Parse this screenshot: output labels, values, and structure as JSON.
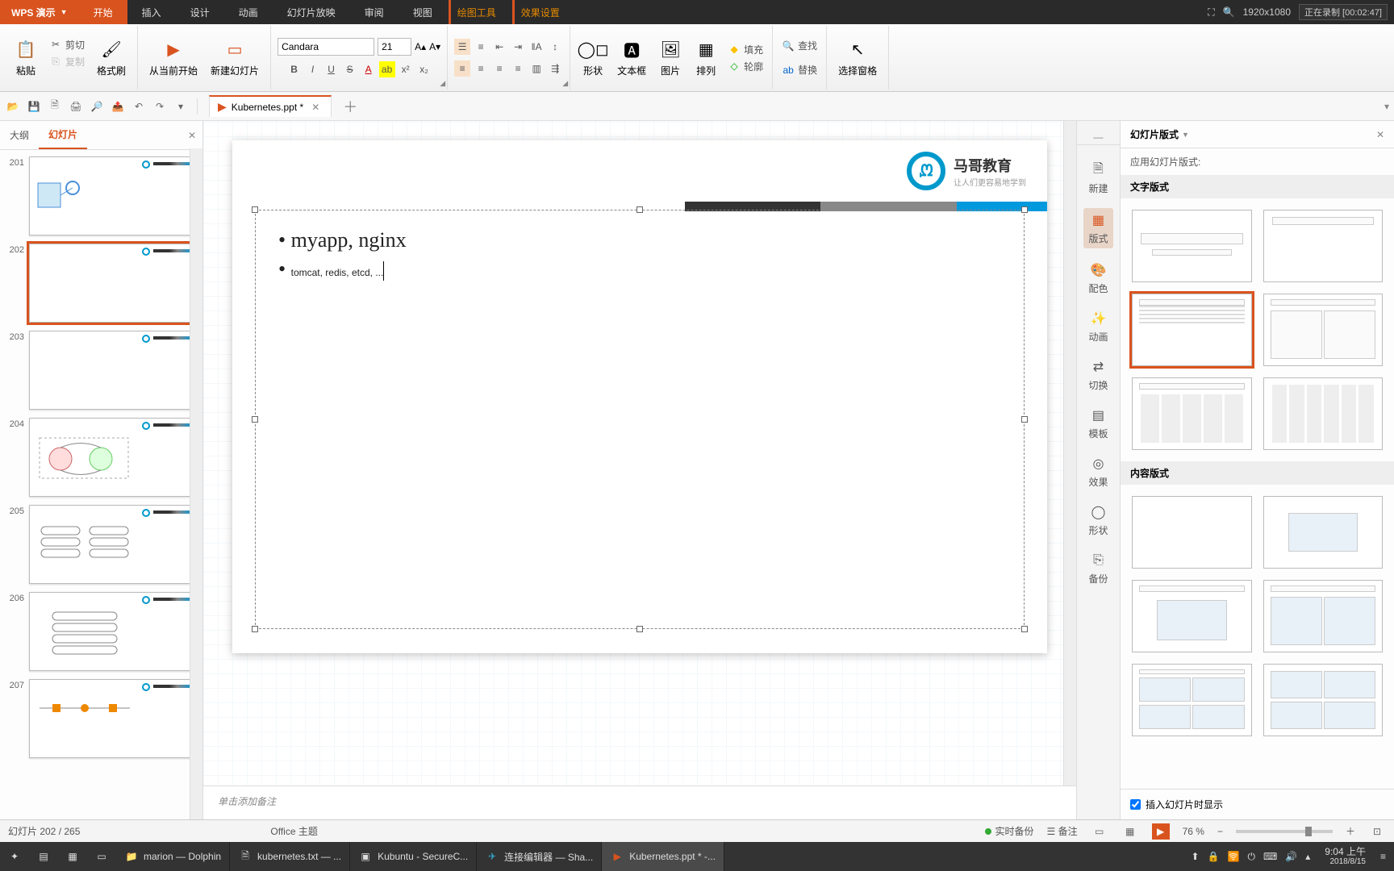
{
  "app": {
    "name": "WPS 演示"
  },
  "menu": {
    "items": [
      "开始",
      "插入",
      "设计",
      "动画",
      "幻灯片放映",
      "审阅",
      "视图"
    ],
    "tools": [
      "绘图工具",
      "效果设置"
    ],
    "active": "开始"
  },
  "titlebar_right": {
    "resolution": "1920x1080",
    "recording": "正在录制 [00:02:47]"
  },
  "ribbon": {
    "paste": "粘贴",
    "cut": "剪切",
    "copy": "复制",
    "format_painter": "格式刷",
    "from_current": "从当前开始",
    "new_slide": "新建幻灯片",
    "font_name": "Candara",
    "font_size": "21",
    "shape": "形状",
    "textbox": "文本框",
    "picture": "图片",
    "arrange": "排列",
    "outline_btn": "轮廓",
    "fill": "填充",
    "find": "查找",
    "replace": "替换",
    "select_pane": "选择窗格"
  },
  "qat": {
    "icons": [
      "folder",
      "save",
      "save-as",
      "print",
      "print-preview",
      "export",
      "undo",
      "redo",
      "dropdown"
    ]
  },
  "doc_tab": {
    "title": "Kubernetes.ppt *"
  },
  "outline_panel": {
    "tab_outline": "大纲",
    "tab_slides": "幻灯片",
    "active_tab": "幻灯片",
    "slides": [
      201,
      202,
      203,
      204,
      205,
      206,
      207
    ],
    "selected": 202
  },
  "slide": {
    "logo_title": "马哥教育",
    "logo_sub": "让人们更容易地学到",
    "bullets": [
      "myapp, nginx",
      "tomcat, redis, etcd, ..."
    ]
  },
  "notes_placeholder": "单击添加备注",
  "right_nav": {
    "items": [
      {
        "id": "new",
        "label": "新建"
      },
      {
        "id": "layout",
        "label": "版式"
      },
      {
        "id": "color",
        "label": "配色"
      },
      {
        "id": "anim",
        "label": "动画"
      },
      {
        "id": "trans",
        "label": "切换"
      },
      {
        "id": "template",
        "label": "模板"
      },
      {
        "id": "effect",
        "label": "效果"
      },
      {
        "id": "shape",
        "label": "形状"
      },
      {
        "id": "backup",
        "label": "备份"
      }
    ],
    "active": "layout"
  },
  "layout_panel": {
    "title": "幻灯片版式",
    "subtitle": "应用幻灯片版式:",
    "section_text": "文字版式",
    "section_content": "内容版式",
    "insert_label": "插入幻灯片时显示"
  },
  "statusbar": {
    "slide_info": "幻灯片 202 / 265",
    "theme": "Office 主题",
    "live_backup": "实时备份",
    "notes": "备注",
    "zoom": "76 %"
  },
  "taskbar": {
    "tasks": [
      {
        "icon": "folder",
        "label": "marion — Dolphin"
      },
      {
        "icon": "doc",
        "label": "kubernetes.txt — ..."
      },
      {
        "icon": "term",
        "label": "Kubuntu - SecureC..."
      },
      {
        "icon": "tg",
        "label": "连接编辑器 — Sha..."
      },
      {
        "icon": "wps",
        "label": "Kubernetes.ppt * -..."
      }
    ],
    "active": 4,
    "time": "9:04 上午",
    "date": "2018/8/15"
  }
}
